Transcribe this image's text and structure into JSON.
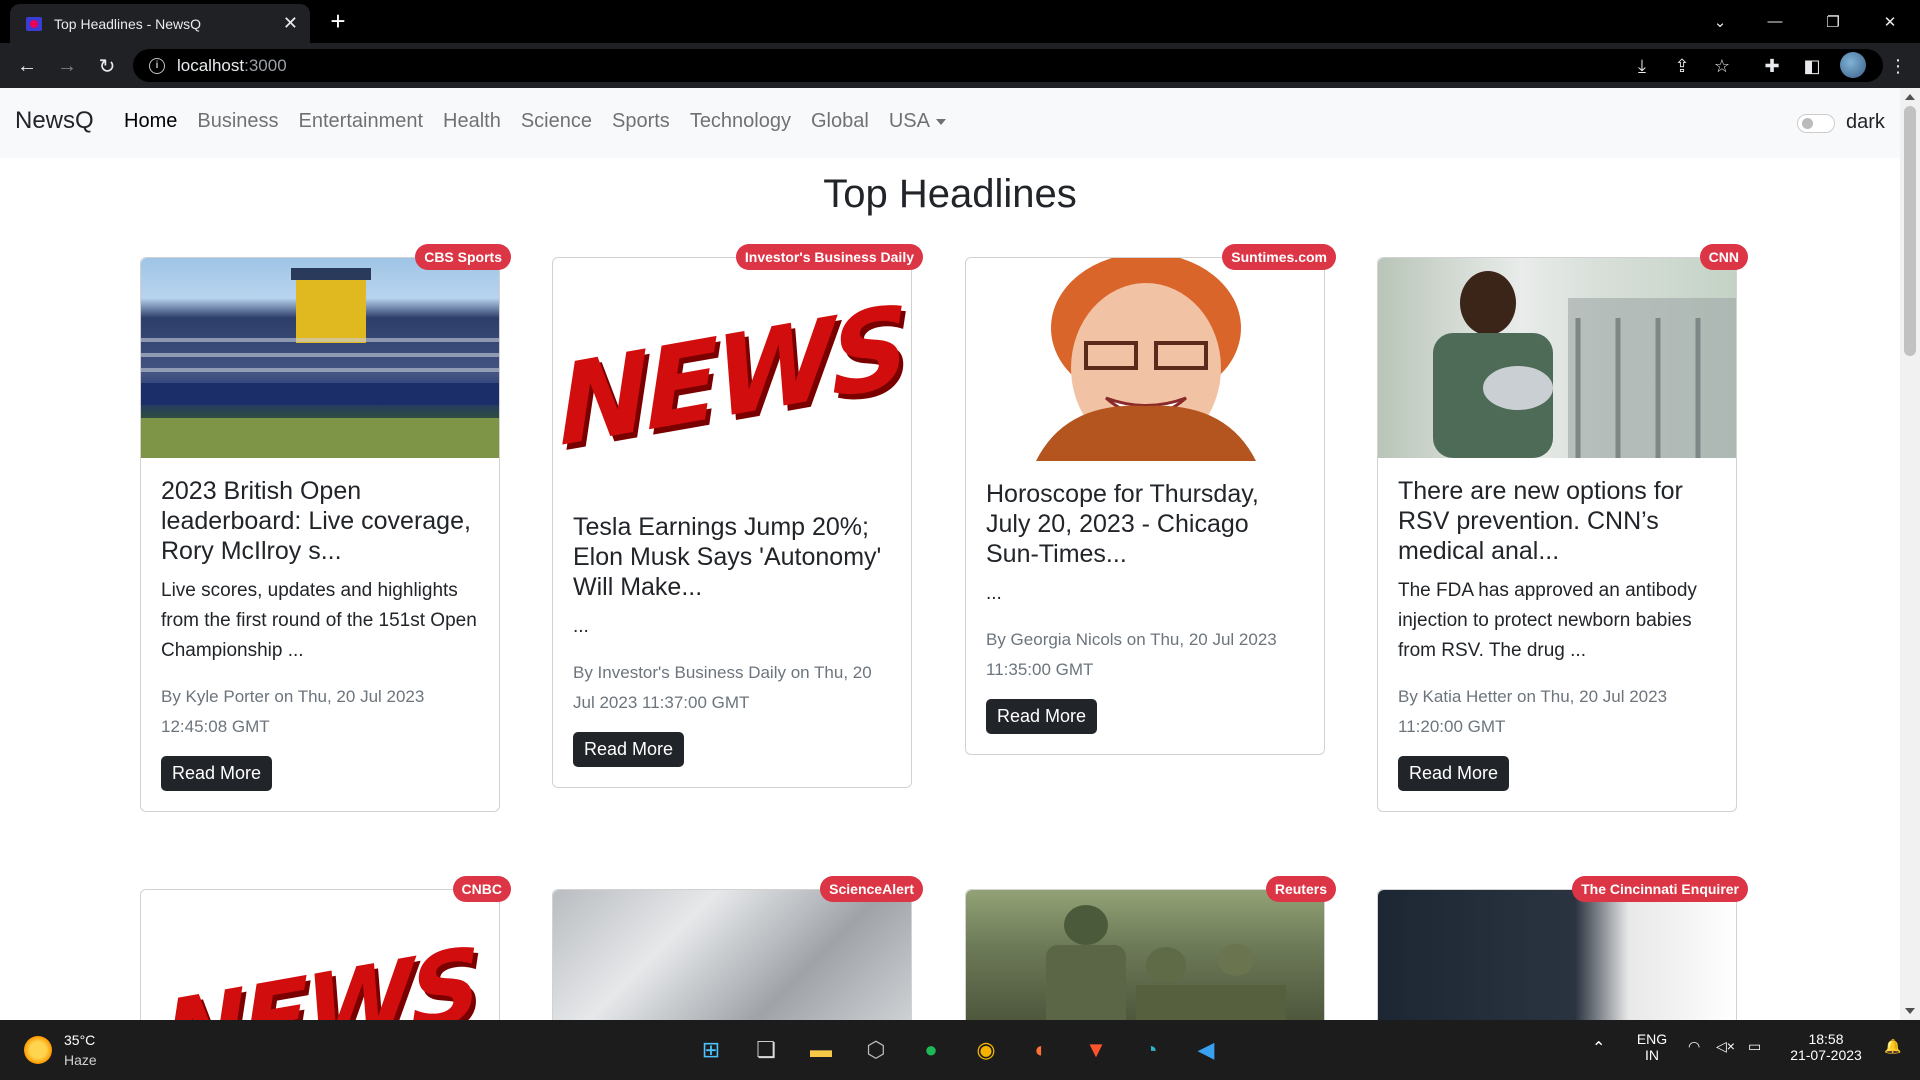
{
  "browser": {
    "tab_title": "Top Headlines - NewsQ",
    "tab_close": "✕",
    "new_tab": "+",
    "url_host": "localhost",
    "url_port": ":3000"
  },
  "app": {
    "brand": "NewsQ",
    "nav": [
      "Home",
      "Business",
      "Entertainment",
      "Health",
      "Science",
      "Sports",
      "Technology",
      "Global",
      "USA"
    ],
    "theme_toggle_label": "dark",
    "heading": "Top Headlines"
  },
  "cards": [
    {
      "source": "CBS Sports",
      "title": "2023 British Open leaderboard: Live coverage, Rory McIlroy s...",
      "text": "Live scores, updates and highlights from the first round of the 151st Open Championship ...",
      "meta": "By Kyle Porter on Thu, 20 Jul 2023 12:45:08 GMT",
      "button": "Read More"
    },
    {
      "source": "Investor's Business Daily",
      "image_text": "NEWS",
      "title": "Tesla Earnings Jump 20%; Elon Musk Says 'Autonomy' Will Make...",
      "text": "...",
      "meta": "By Investor's Business Daily on Thu, 20 Jul 2023 11:37:00 GMT",
      "button": "Read More"
    },
    {
      "source": "Suntimes.com",
      "title": "Horoscope for Thursday, July 20, 2023 - Chicago Sun-Times...",
      "text": "...",
      "meta": "By Georgia Nicols on Thu, 20 Jul 2023 11:35:00 GMT",
      "button": "Read More"
    },
    {
      "source": "CNN",
      "title": "There are new options for RSV prevention. CNN’s medical anal...",
      "text": "The FDA has approved an antibody injection to protect newborn babies from RSV. The drug ...",
      "meta": "By Katia Hetter on Thu, 20 Jul 2023 11:20:00 GMT",
      "button": "Read More"
    }
  ],
  "cards_row2": [
    {
      "source": "CNBC",
      "image_text": "NEWS"
    },
    {
      "source": "ScienceAlert"
    },
    {
      "source": "Reuters"
    },
    {
      "source": "The Cincinnati Enquirer"
    }
  ],
  "taskbar": {
    "temp": "35°C",
    "condition": "Haze",
    "lang1": "ENG",
    "lang2": "IN",
    "time": "18:58",
    "date": "21-07-2023"
  },
  "colors": {
    "badge": "#dc3545",
    "button": "#212529",
    "navbar_bg": "#f8f9fa"
  }
}
